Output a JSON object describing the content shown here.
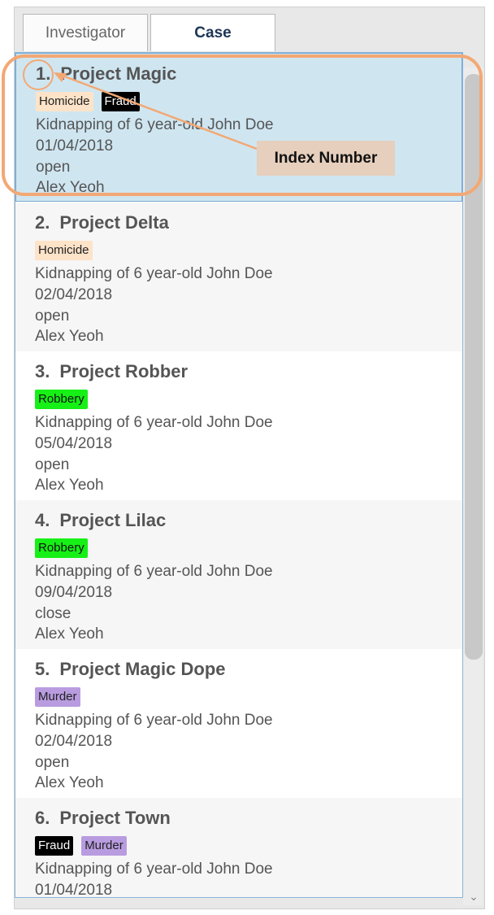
{
  "tabs": [
    {
      "label": "Investigator",
      "active": false
    },
    {
      "label": "Case",
      "active": true
    }
  ],
  "cases": [
    {
      "index": "1.",
      "name": "Project Magic",
      "tags": [
        {
          "label": "Homicide",
          "kind": "homicide"
        },
        {
          "label": "Fraud",
          "kind": "fraud"
        }
      ],
      "description": "Kidnapping of 6 year-old John Doe",
      "date": "01/04/2018",
      "status": "open",
      "investigator": "Alex Yeoh",
      "selected": true
    },
    {
      "index": "2.",
      "name": "Project Delta",
      "tags": [
        {
          "label": "Homicide",
          "kind": "homicide"
        }
      ],
      "description": "Kidnapping of 6 year-old John Doe",
      "date": "02/04/2018",
      "status": "open",
      "investigator": "Alex Yeoh"
    },
    {
      "index": "3.",
      "name": "Project Robber",
      "tags": [
        {
          "label": "Robbery",
          "kind": "robbery"
        }
      ],
      "description": "Kidnapping of 6 year-old John Doe",
      "date": "05/04/2018",
      "status": "open",
      "investigator": "Alex Yeoh"
    },
    {
      "index": "4.",
      "name": "Project Lilac",
      "tags": [
        {
          "label": "Robbery",
          "kind": "robbery"
        }
      ],
      "description": "Kidnapping of 6 year-old John Doe",
      "date": "09/04/2018",
      "status": "close",
      "investigator": "Alex Yeoh"
    },
    {
      "index": "5.",
      "name": "Project Magic Dope",
      "tags": [
        {
          "label": "Murder",
          "kind": "murder"
        }
      ],
      "description": "Kidnapping of 6 year-old John Doe",
      "date": "02/04/2018",
      "status": "open",
      "investigator": "Alex Yeoh"
    },
    {
      "index": "6.",
      "name": "Project Town",
      "tags": [
        {
          "label": "Fraud",
          "kind": "fraud"
        },
        {
          "label": "Murder",
          "kind": "murder"
        }
      ],
      "description": "Kidnapping of 6 year-old John Doe",
      "date": "01/04/2018",
      "status": "",
      "investigator": ""
    }
  ],
  "annotation": {
    "callout_label": "Index Number",
    "highlight_color": "#f3a874"
  },
  "colors": {
    "selected_row": "#cfe6f1",
    "tag_homicide": "#fde3c8",
    "tag_fraud": "#000000",
    "tag_robbery": "#16f016",
    "tag_murder": "#b99ce0"
  },
  "icons": {
    "scroll_down": "chevron-down-icon"
  }
}
